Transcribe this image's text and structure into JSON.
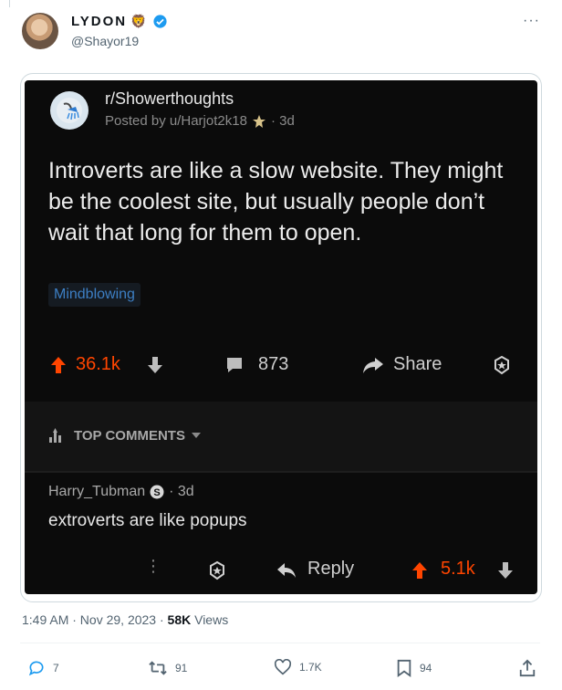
{
  "author": {
    "display_name": "LYDON",
    "handle": "@Shayor19",
    "emoji": "🦁"
  },
  "more_label": "···",
  "reddit": {
    "subreddit": "r/Showerthoughts",
    "posted_by": "Posted by u/Harjot2k18",
    "age": "· 3d",
    "title": "Introverts are like a slow website. They might be the coolest site, but usually people don’t wait that long for them to open.",
    "flair": "Mindblowing",
    "upvotes": "36.1k",
    "comments": "873",
    "share": "Share",
    "top_comments": "TOP COMMENTS",
    "comment": {
      "author": "Harry_Tubman",
      "age": "· 3d",
      "text": "extroverts are like popups",
      "reply": "Reply",
      "votes": "5.1k"
    }
  },
  "tweet_meta": {
    "time": "1:49 AM · Nov 29, 2023 · ",
    "views_count": "58K",
    "views_label": " Views"
  },
  "stats": {
    "replies": "7",
    "retweets": "91",
    "likes": "1.7K",
    "bookmarks": "94"
  },
  "colors": {
    "upvote": "#ff4500",
    "verified": "#1d9bf0",
    "flair": "#3d7fc4"
  }
}
